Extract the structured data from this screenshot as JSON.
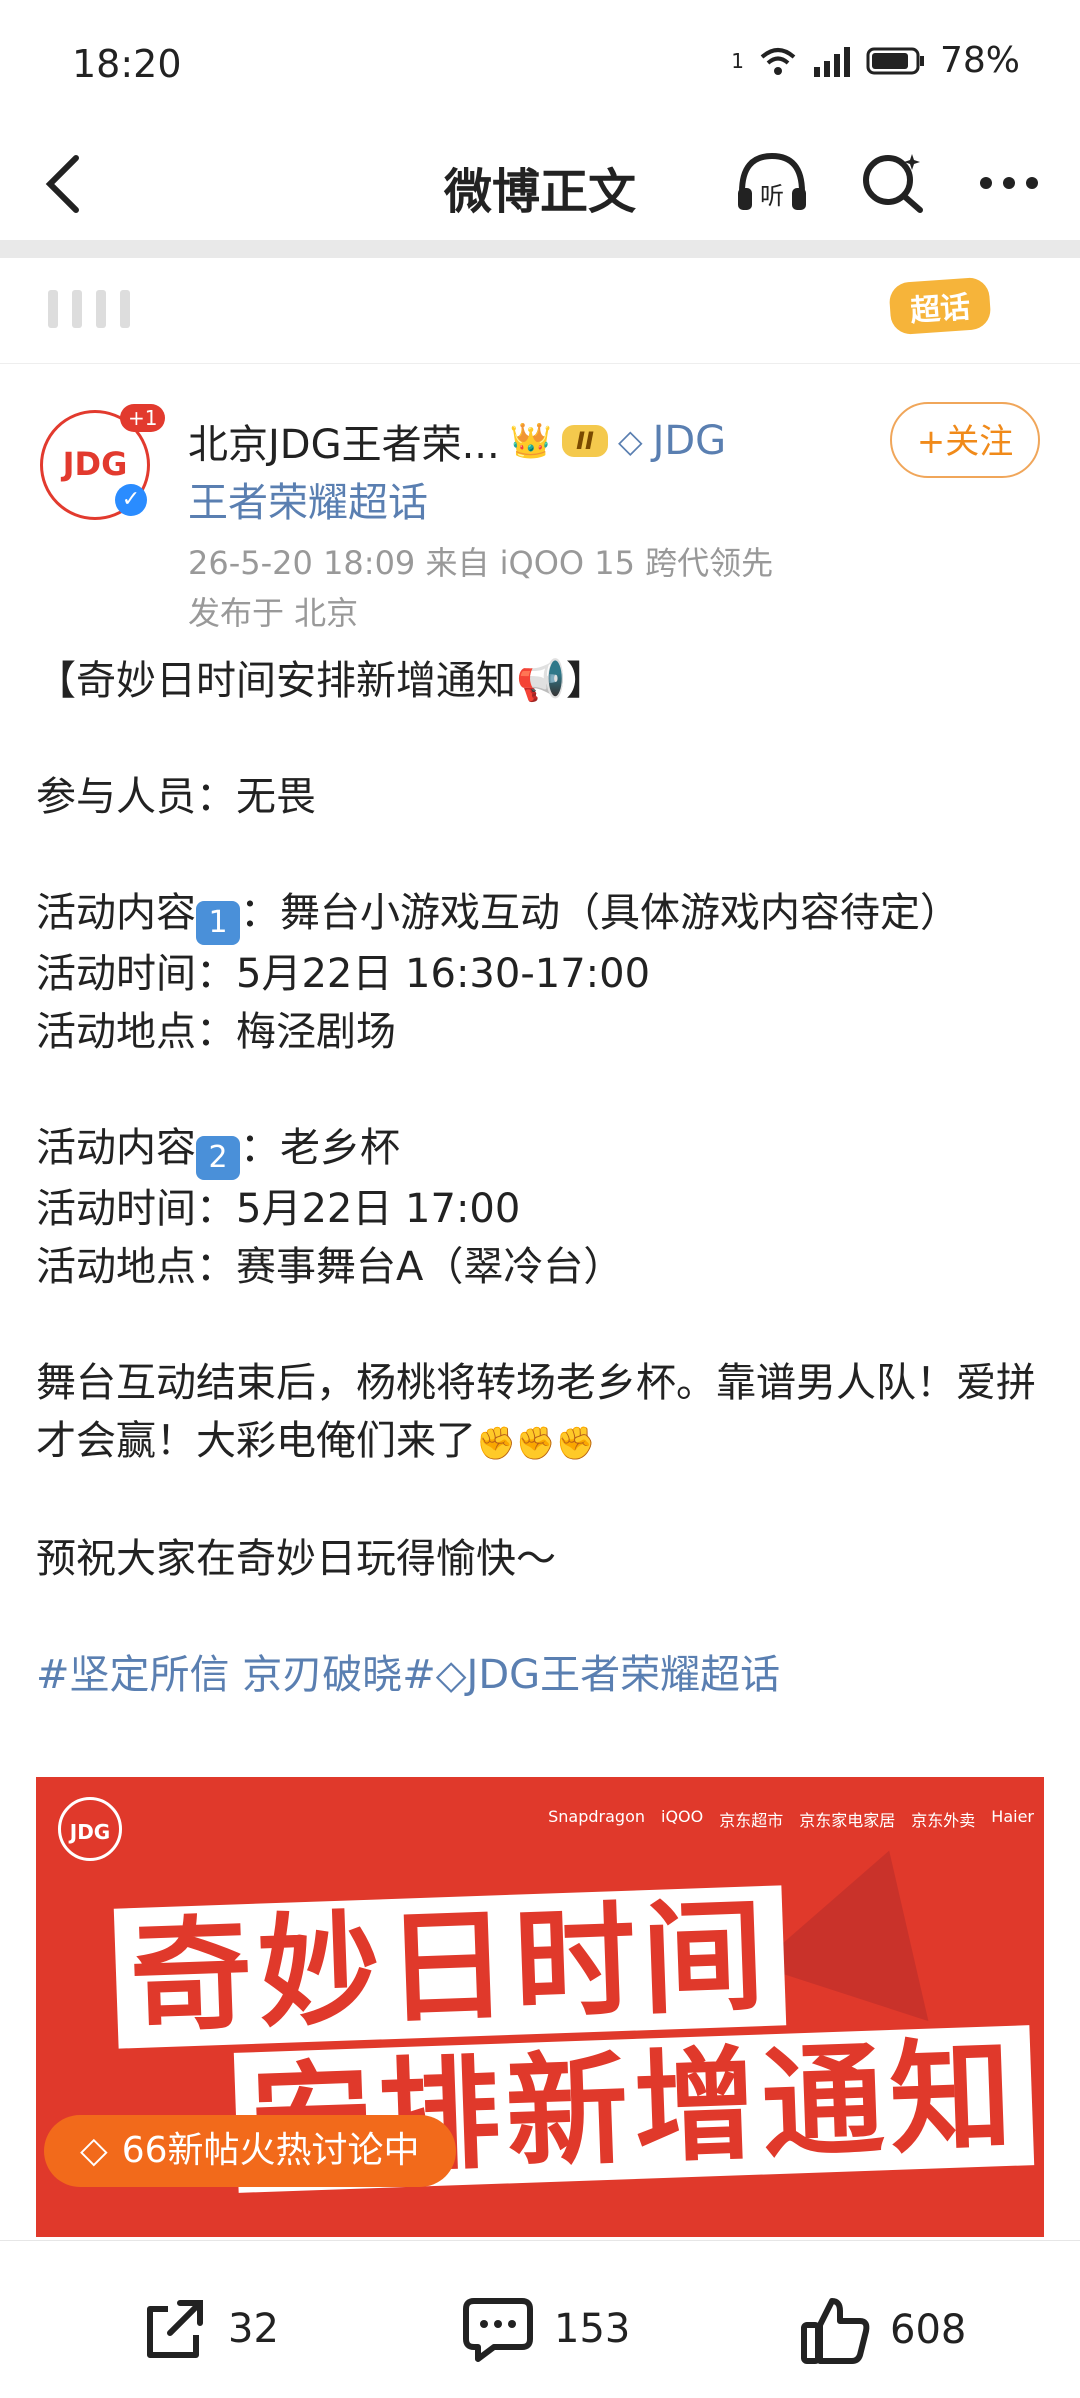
{
  "status_bar": {
    "time": "18:20",
    "sim_label": "1",
    "battery": "78%"
  },
  "nav": {
    "title": "微博正文"
  },
  "super_topic": {
    "badge": "超话"
  },
  "post": {
    "author_line1": "北京JDG王者荣...",
    "rank_badge": "II",
    "topic_label": "JDG",
    "author_line2": "王者荣耀超话",
    "plus_badge": "+1",
    "avatar_text": "JDG",
    "meta": "26-5-20 18:09  来自 iQOO 15 跨代领先",
    "location": "发布于 北京",
    "follow_label": "+关注",
    "title": "【奇妙日时间安排新增通知",
    "participants": "参与人员：无畏",
    "act1_content": "活动内容",
    "act1_num": "1",
    "act1_desc": "：舞台小游戏互动（具体游戏内容待定）",
    "act1_time": "活动时间：5月22日   16:30-17:00",
    "act1_place": "活动地点：梅泾剧场",
    "act2_content": "活动内容",
    "act2_num": "2",
    "act2_desc": "：老乡杯",
    "act2_time": "活动时间：5月22日   17:00",
    "act2_place": "活动地点：赛事舞台A（翠冷台）",
    "closing": "舞台互动结束后，杨桃将转场老乡杯。靠谱男人队！爱拼才会赢！大彩电俺们来了",
    "wish": "预祝大家在奇妙日玩得愉快～",
    "tags": "#坚定所信 京刃破晓#",
    "tags2": "JDG王者荣耀超话"
  },
  "poster": {
    "line1": "奇妙日时间",
    "line2": "安排新增通知",
    "logo": "JDG",
    "sponsors": [
      "Snapdragon",
      "iQOO",
      "京东超市",
      "京东家电家居",
      "京东外卖",
      "Haier"
    ]
  },
  "hot_pill": "66新帖火热讨论中",
  "actions": {
    "share_count": "32",
    "comment_count": "153",
    "like_count": "608"
  }
}
